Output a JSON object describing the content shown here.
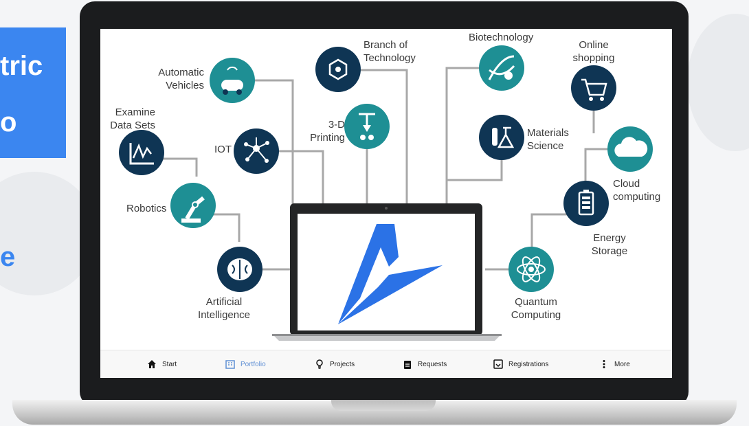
{
  "headline": {
    "line1": "tric",
    "line2": "o",
    "line3": "e"
  },
  "diagram": {
    "labels": {
      "automatic_vehicles": "Automatic\nVehicles",
      "examine_data_sets": "Examine\nData Sets",
      "iot": "IOT",
      "robotics": "Robotics",
      "artificial_intelligence": "Artificial\nIntelligence",
      "branch_of_technology": "Branch of\nTechnology",
      "printing_3d": "3-D\nPrinting",
      "biotechnology": "Biotechnology",
      "materials_science": "Materials\nScience",
      "online_shopping": "Online\nshopping",
      "cloud_computing": "Cloud\ncomputing",
      "energy_storage": "Energy\nStorage",
      "quantum_computing": "Quantum\nComputing"
    },
    "colors": {
      "navy": "#0f3554",
      "teal": "#1e8f94",
      "line": "#a8a8a8",
      "logo": "#2b72e6"
    }
  },
  "nav": {
    "items": [
      {
        "label": "Start",
        "icon": "home-icon"
      },
      {
        "label": "Portfolio",
        "icon": "building-icon"
      },
      {
        "label": "Projects",
        "icon": "lightbulb-icon"
      },
      {
        "label": "Requests",
        "icon": "clipboard-icon"
      },
      {
        "label": "Registrations",
        "icon": "registration-icon"
      },
      {
        "label": "More",
        "icon": "more-vertical-icon"
      }
    ]
  }
}
